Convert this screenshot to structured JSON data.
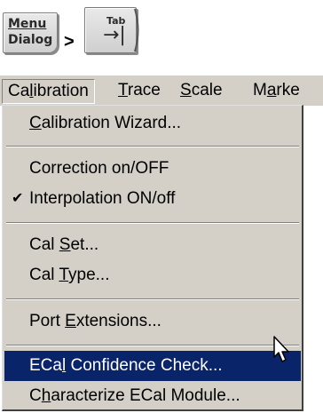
{
  "keys": {
    "menu_dialog": {
      "line1": "Menu",
      "line2": "Dialog"
    },
    "separator": ">",
    "tab": {
      "label": "Tab",
      "glyph": "→|"
    }
  },
  "menubar": {
    "items": [
      {
        "label_pre": "Ca",
        "label_u": "l",
        "label_post": "ibration",
        "active": true
      },
      {
        "label_pre": "",
        "label_u": "T",
        "label_post": "race"
      },
      {
        "label_pre": "",
        "label_u": "S",
        "label_post": "cale"
      },
      {
        "label_pre": "M",
        "label_u": "a",
        "label_post": "rke"
      }
    ]
  },
  "menu": {
    "items": [
      {
        "pre": "",
        "u": "C",
        "post": "alibration Wizard..."
      },
      {
        "pre": "Correction on/OFF",
        "u": "",
        "post": ""
      },
      {
        "pre": "Interpolation ON/off",
        "u": "",
        "post": "",
        "checked": true
      },
      {
        "pre": "Cal ",
        "u": "S",
        "post": "et..."
      },
      {
        "pre": "Cal ",
        "u": "T",
        "post": "ype..."
      },
      {
        "pre": "Port ",
        "u": "E",
        "post": "xtensions..."
      },
      {
        "pre": "ECa",
        "u": "l",
        "post": " Confidence Check...",
        "highlighted": true
      },
      {
        "pre": "C",
        "u": "h",
        "post": "aracterize ECal Module..."
      }
    ],
    "check_glyph": "✔"
  },
  "colors": {
    "menu_bg": "#d4d0c8",
    "highlight_bg": "#0a246a",
    "highlight_fg": "#ffffff"
  }
}
